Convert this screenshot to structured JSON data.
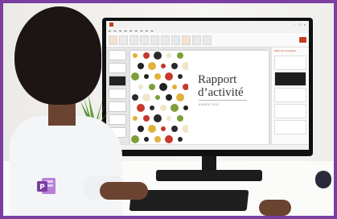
{
  "slide": {
    "title": "Rapport d’activité",
    "subtitle": "ANNÉE 2022"
  },
  "designer": {
    "title": "Idées de conception"
  },
  "app": {
    "logo_icon": "powerpoint-logo-icon",
    "brand_color": "#7a3fa0",
    "accent_color": "#c43e1c"
  }
}
